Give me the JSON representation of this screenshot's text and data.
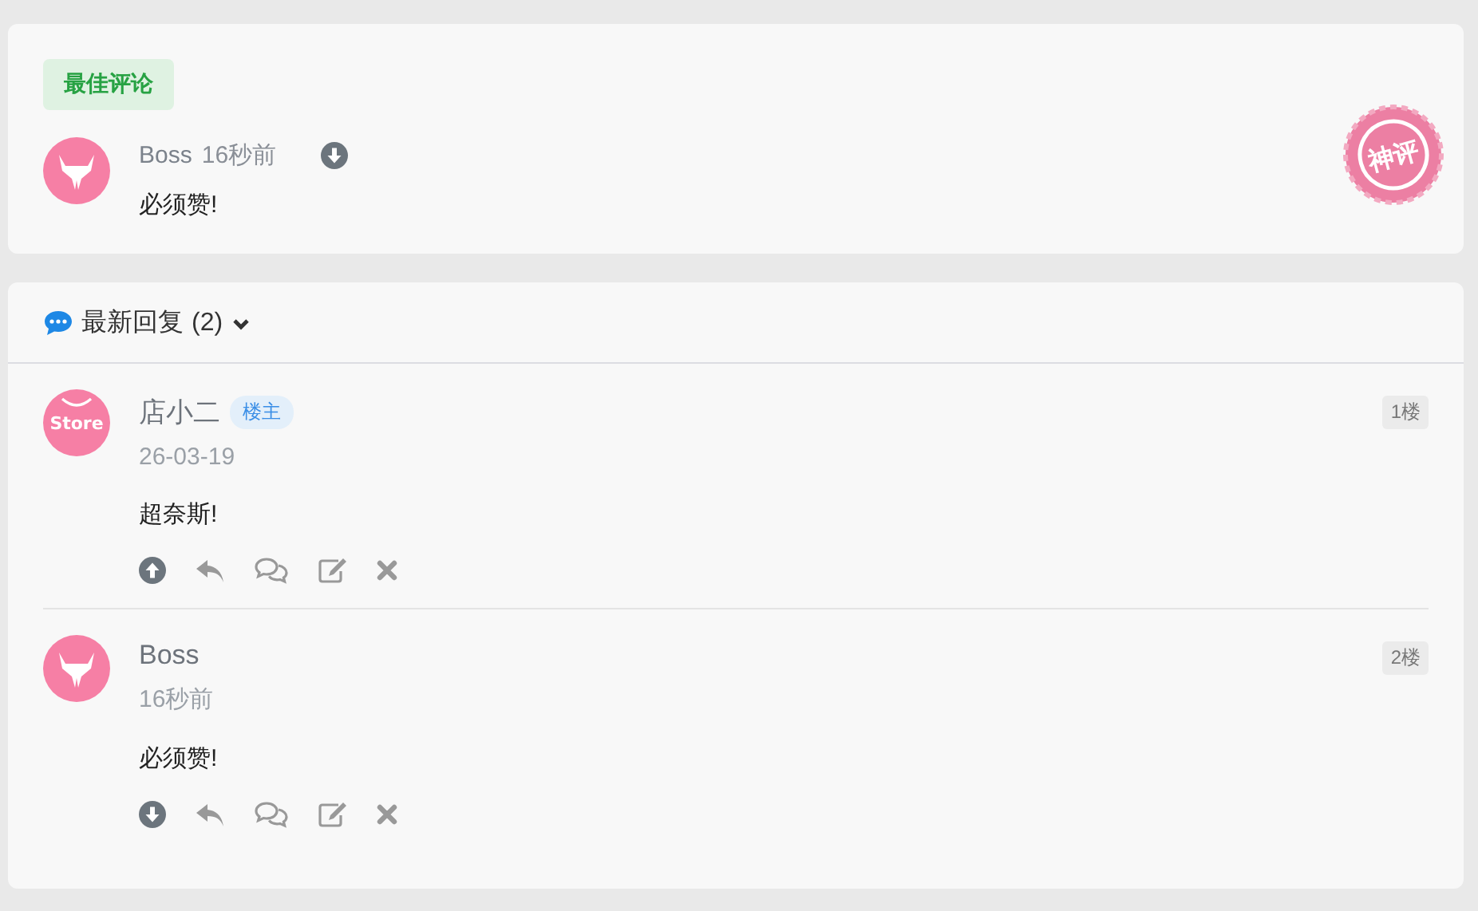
{
  "best_comment": {
    "tag": "最佳评论",
    "author": "Boss",
    "avatar": {
      "kind": "fox"
    },
    "time": "16秒前",
    "vote": {
      "kind": "down"
    },
    "content": "必须赞!",
    "stamp": "神评"
  },
  "replies": {
    "title": "最新回复",
    "count": "(2)",
    "expanded": true,
    "items": [
      {
        "author": "店小二",
        "avatar": {
          "kind": "store",
          "text": "Store"
        },
        "badge": "楼主",
        "time": "26-03-19",
        "floor": "1楼",
        "content": "超奈斯!",
        "vote": {
          "kind": "up"
        }
      },
      {
        "author": "Boss",
        "avatar": {
          "kind": "fox"
        },
        "time": "16秒前",
        "floor": "2楼",
        "content": "必须赞!",
        "vote": {
          "kind": "down"
        }
      }
    ]
  }
}
